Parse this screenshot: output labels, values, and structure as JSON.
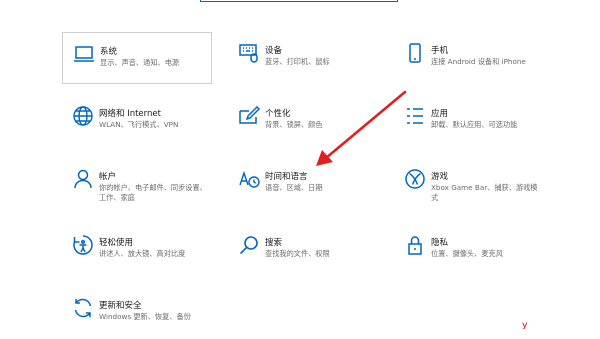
{
  "tiles": [
    {
      "label": "系统",
      "desc": "显示、声音、通知、电源",
      "icon": "laptop-icon"
    },
    {
      "label": "设备",
      "desc": "蓝牙、打印机、鼠标",
      "icon": "keyboard-icon"
    },
    {
      "label": "手机",
      "desc": "连接 Android 设备和 iPhone",
      "icon": "phone-icon"
    },
    {
      "label": "网络和 Internet",
      "desc": "WLAN、飞行模式、VPN",
      "icon": "globe-icon"
    },
    {
      "label": "个性化",
      "desc": "背景、锁屏、颜色",
      "icon": "paint-icon"
    },
    {
      "label": "应用",
      "desc": "卸载、默认应用、可选功能",
      "icon": "apps-icon"
    },
    {
      "label": "帐户",
      "desc": "你的帐户、电子邮件、同步设置、工作、家庭",
      "icon": "person-icon"
    },
    {
      "label": "时间和语言",
      "desc": "语音、区域、日期",
      "icon": "time-language-icon"
    },
    {
      "label": "游戏",
      "desc": "Xbox Game Bar、捕获、游戏模式",
      "icon": "xbox-icon"
    },
    {
      "label": "轻松使用",
      "desc": "讲述人、放大镜、高对比度",
      "icon": "ease-of-access-icon"
    },
    {
      "label": "搜索",
      "desc": "查找我的文件、权限",
      "icon": "search-icon"
    },
    {
      "label": "隐私",
      "desc": "位置、摄像头、麦克风",
      "icon": "lock-icon"
    },
    {
      "label": "更新和安全",
      "desc": "Windows 更新、恢复、备份",
      "icon": "sync-icon"
    }
  ],
  "corner_mark": "У",
  "colors": {
    "accent": "#0067c0",
    "annotation": "#e02020"
  }
}
